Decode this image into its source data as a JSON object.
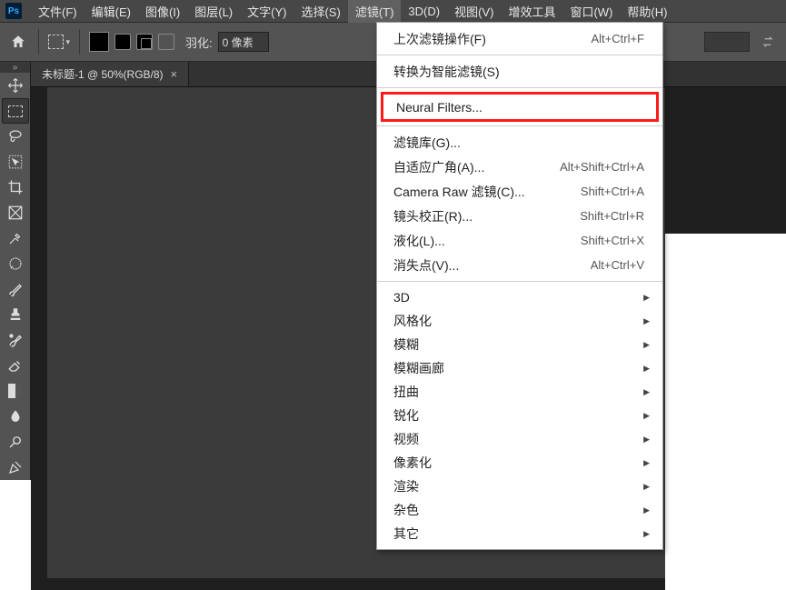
{
  "logo_text": "Ps",
  "menubar": {
    "items": [
      "文件(F)",
      "编辑(E)",
      "图像(I)",
      "图层(L)",
      "文字(Y)",
      "选择(S)",
      "滤镜(T)",
      "3D(D)",
      "视图(V)",
      "增效工具",
      "窗口(W)",
      "帮助(H)"
    ],
    "active_index": 6
  },
  "optionsbar": {
    "feather_label": "羽化:",
    "feather_value": "0 像素"
  },
  "tab": {
    "title": "未标题-1 @ 50%(RGB/8)",
    "close_glyph": "×"
  },
  "dropdown": {
    "last_filter": {
      "label": "上次滤镜操作(F)",
      "shortcut": "Alt+Ctrl+F"
    },
    "convert_smart": "转换为智能滤镜(S)",
    "neural": "Neural Filters...",
    "group2": [
      {
        "label": "滤镜库(G)...",
        "shortcut": ""
      },
      {
        "label": "自适应广角(A)...",
        "shortcut": "Alt+Shift+Ctrl+A"
      },
      {
        "label": "Camera Raw 滤镜(C)...",
        "shortcut": "Shift+Ctrl+A"
      },
      {
        "label": "镜头校正(R)...",
        "shortcut": "Shift+Ctrl+R"
      },
      {
        "label": "液化(L)...",
        "shortcut": "Shift+Ctrl+X"
      },
      {
        "label": "消失点(V)...",
        "shortcut": "Alt+Ctrl+V"
      }
    ],
    "group3": [
      "3D",
      "风格化",
      "模糊",
      "模糊画廊",
      "扭曲",
      "锐化",
      "视频",
      "像素化",
      "渲染",
      "杂色",
      "其它"
    ]
  }
}
